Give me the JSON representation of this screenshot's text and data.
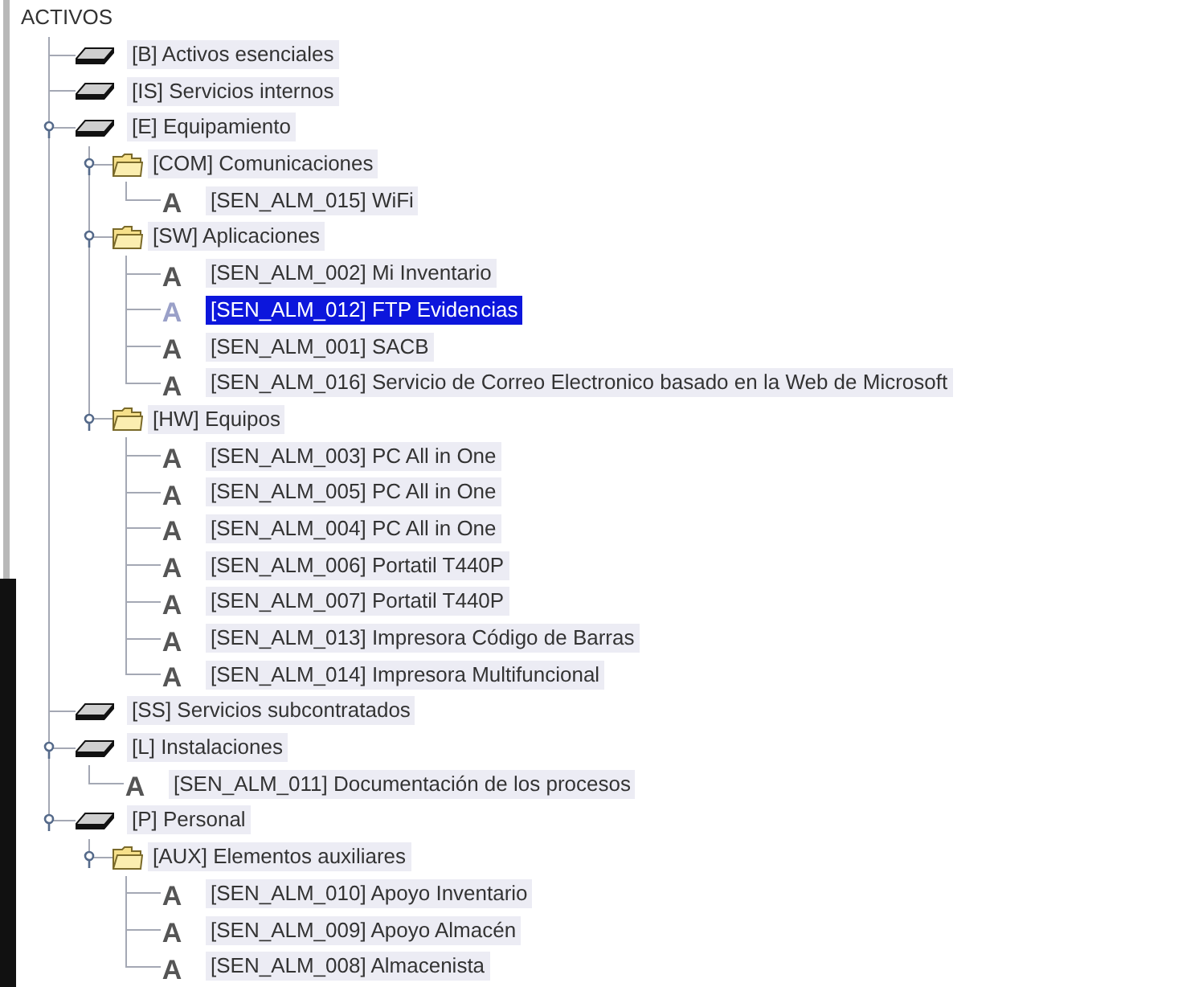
{
  "tree": {
    "root": {
      "label": "ACTIVOS",
      "selected": false
    },
    "nodes": [
      {
        "kind": "layer",
        "label": "[B] Activos esenciales",
        "selected": false
      },
      {
        "kind": "layer",
        "label": "[IS] Servicios internos",
        "selected": false
      },
      {
        "kind": "layer",
        "label": "[E] Equipamiento",
        "selected": false,
        "expanded": true,
        "children": [
          {
            "kind": "folder",
            "label": "[COM] Comunicaciones",
            "selected": false,
            "expanded": true,
            "children": [
              {
                "kind": "asset",
                "glyph": "A",
                "label": "[SEN_ALM_015] WiFi",
                "selected": false
              }
            ]
          },
          {
            "kind": "folder",
            "label": "[SW] Aplicaciones",
            "selected": false,
            "expanded": true,
            "children": [
              {
                "kind": "asset",
                "glyph": "A",
                "label": "[SEN_ALM_002] Mi Inventario",
                "selected": false
              },
              {
                "kind": "asset",
                "glyph": "A",
                "label": "[SEN_ALM_012] FTP Evidencias",
                "selected": true
              },
              {
                "kind": "asset",
                "glyph": "A",
                "label": "[SEN_ALM_001] SACB",
                "selected": false
              },
              {
                "kind": "asset",
                "glyph": "A",
                "label": "[SEN_ALM_016] Servicio de Correo Electronico basado en la Web de Microsoft",
                "selected": false
              }
            ]
          },
          {
            "kind": "folder",
            "label": "[HW] Equipos",
            "selected": false,
            "expanded": true,
            "children": [
              {
                "kind": "asset",
                "glyph": "A",
                "label": "[SEN_ALM_003] PC All in One",
                "selected": false
              },
              {
                "kind": "asset",
                "glyph": "A",
                "label": "[SEN_ALM_005] PC All in One",
                "selected": false
              },
              {
                "kind": "asset",
                "glyph": "A",
                "label": "[SEN_ALM_004] PC All in One",
                "selected": false
              },
              {
                "kind": "asset",
                "glyph": "A",
                "label": "[SEN_ALM_006] Portatil T440P",
                "selected": false
              },
              {
                "kind": "asset",
                "glyph": "A",
                "label": "[SEN_ALM_007] Portatil T440P",
                "selected": false
              },
              {
                "kind": "asset",
                "glyph": "A",
                "label": "[SEN_ALM_013] Impresora Código de Barras",
                "selected": false
              },
              {
                "kind": "asset",
                "glyph": "A",
                "label": "[SEN_ALM_014] Impresora Multifuncional",
                "selected": false
              }
            ]
          }
        ]
      },
      {
        "kind": "layer",
        "label": "[SS] Servicios subcontratados",
        "selected": false
      },
      {
        "kind": "layer",
        "label": "[L] Instalaciones",
        "selected": false,
        "expanded": true,
        "children": [
          {
            "kind": "asset",
            "glyph": "A",
            "label": "[SEN_ALM_011] Documentación de los procesos",
            "selected": false
          }
        ]
      },
      {
        "kind": "layer",
        "label": "[P] Personal",
        "selected": false,
        "expanded": true,
        "children": [
          {
            "kind": "folder",
            "label": "[AUX] Elementos auxiliares",
            "selected": false,
            "expanded": true,
            "children": [
              {
                "kind": "asset",
                "glyph": "A",
                "label": "[SEN_ALM_010] Apoyo Inventario",
                "selected": false
              },
              {
                "kind": "asset",
                "glyph": "A",
                "label": "[SEN_ALM_009] Apoyo Almacén",
                "selected": false
              },
              {
                "kind": "asset",
                "glyph": "A",
                "label": "[SEN_ALM_008] Almacenista",
                "selected": false
              }
            ]
          }
        ]
      }
    ]
  }
}
